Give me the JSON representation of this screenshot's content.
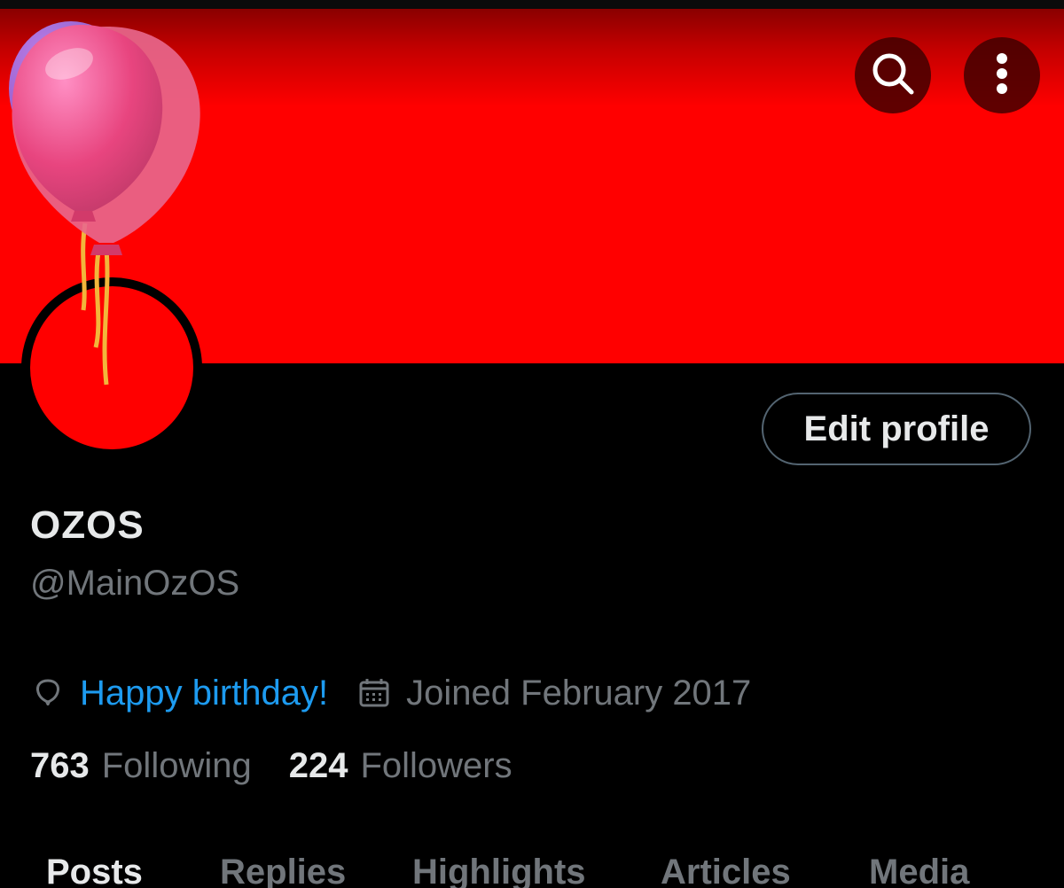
{
  "header": {
    "search_icon": "search-icon",
    "more_icon": "more-vertical-icon"
  },
  "profile": {
    "display_name": "OZOS",
    "handle": "@MainOzOS",
    "edit_label": "Edit profile",
    "birthday_text": "Happy birthday!",
    "birthday_icon": "balloon-icon",
    "joined_text": "Joined February 2017",
    "joined_icon": "calendar-icon",
    "avatar_color": "#ff0000",
    "banner_color": "#ff0000"
  },
  "stats": {
    "following_count": "763",
    "following_label": "Following",
    "followers_count": "224",
    "followers_label": "Followers"
  },
  "tabs": [
    {
      "label": "Posts"
    },
    {
      "label": "Replies"
    },
    {
      "label": "Highlights"
    },
    {
      "label": "Articles"
    },
    {
      "label": "Media"
    }
  ],
  "colors": {
    "accent": "#1d9bf0",
    "muted_text": "#71767b",
    "primary_text": "#e7e9ea",
    "background": "#000000"
  }
}
